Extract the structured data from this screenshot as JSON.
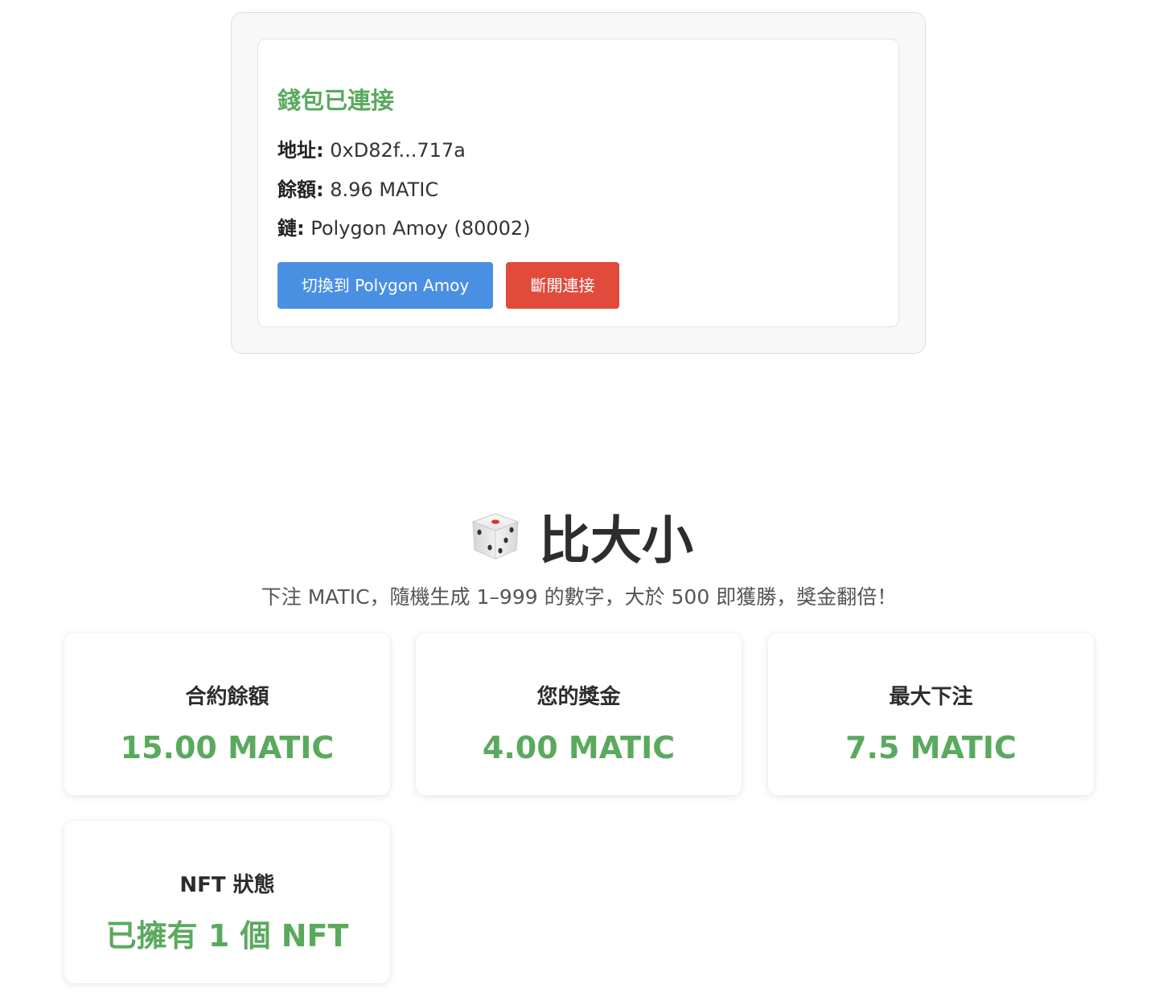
{
  "colors": {
    "success_green": "#5aaa5d",
    "switch_button_blue": "#4a90e2",
    "disconnect_button_red": "#e04b3c"
  },
  "wallet": {
    "status": "錢包已連接",
    "address_label": "地址:",
    "address_value": "0xD82f...717a",
    "balance_label": "餘額:",
    "balance_value": "8.96 MATIC",
    "chain_label": "鏈:",
    "chain_value": "Polygon Amoy (80002)",
    "switch_button": "切換到 Polygon Amoy",
    "disconnect_button": "斷開連接"
  },
  "game": {
    "icon": "dice-icon",
    "title": "比大小",
    "description": "下注 MATIC，隨機生成 1–999 的數字，大於 500 即獲勝，獎金翻倍！"
  },
  "stats": [
    {
      "label": "合約餘額",
      "value": "15.00 MATIC"
    },
    {
      "label": "您的獎金",
      "value": "4.00 MATIC"
    },
    {
      "label": "最大下注",
      "value": "7.5 MATIC"
    },
    {
      "label": "NFT 狀態",
      "value": "已擁有 1 個 NFT"
    }
  ]
}
